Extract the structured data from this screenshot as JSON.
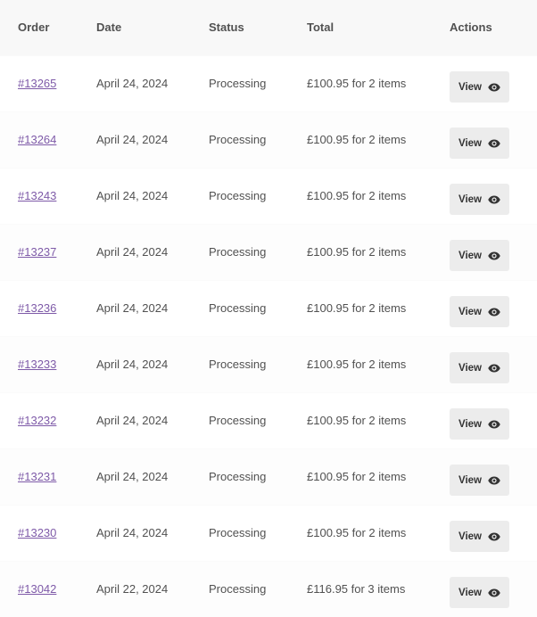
{
  "table": {
    "headers": {
      "order": "Order",
      "date": "Date",
      "status": "Status",
      "total": "Total",
      "actions": "Actions"
    },
    "view_label": "View",
    "view_icon": "eye-icon",
    "link_color": "#7e5aa8",
    "rows": [
      {
        "order": "#13265",
        "date": "April 24, 2024",
        "status": "Processing",
        "total": "£100.95 for 2 items"
      },
      {
        "order": "#13264",
        "date": "April 24, 2024",
        "status": "Processing",
        "total": "£100.95 for 2 items"
      },
      {
        "order": "#13243",
        "date": "April 24, 2024",
        "status": "Processing",
        "total": "£100.95 for 2 items"
      },
      {
        "order": "#13237",
        "date": "April 24, 2024",
        "status": "Processing",
        "total": "£100.95 for 2 items"
      },
      {
        "order": "#13236",
        "date": "April 24, 2024",
        "status": "Processing",
        "total": "£100.95 for 2 items"
      },
      {
        "order": "#13233",
        "date": "April 24, 2024",
        "status": "Processing",
        "total": "£100.95 for 2 items"
      },
      {
        "order": "#13232",
        "date": "April 24, 2024",
        "status": "Processing",
        "total": "£100.95 for 2 items"
      },
      {
        "order": "#13231",
        "date": "April 24, 2024",
        "status": "Processing",
        "total": "£100.95 for 2 items"
      },
      {
        "order": "#13230",
        "date": "April 24, 2024",
        "status": "Processing",
        "total": "£100.95 for 2 items"
      },
      {
        "order": "#13042",
        "date": "April 22, 2024",
        "status": "Processing",
        "total": "£116.95 for 3 items"
      }
    ]
  }
}
